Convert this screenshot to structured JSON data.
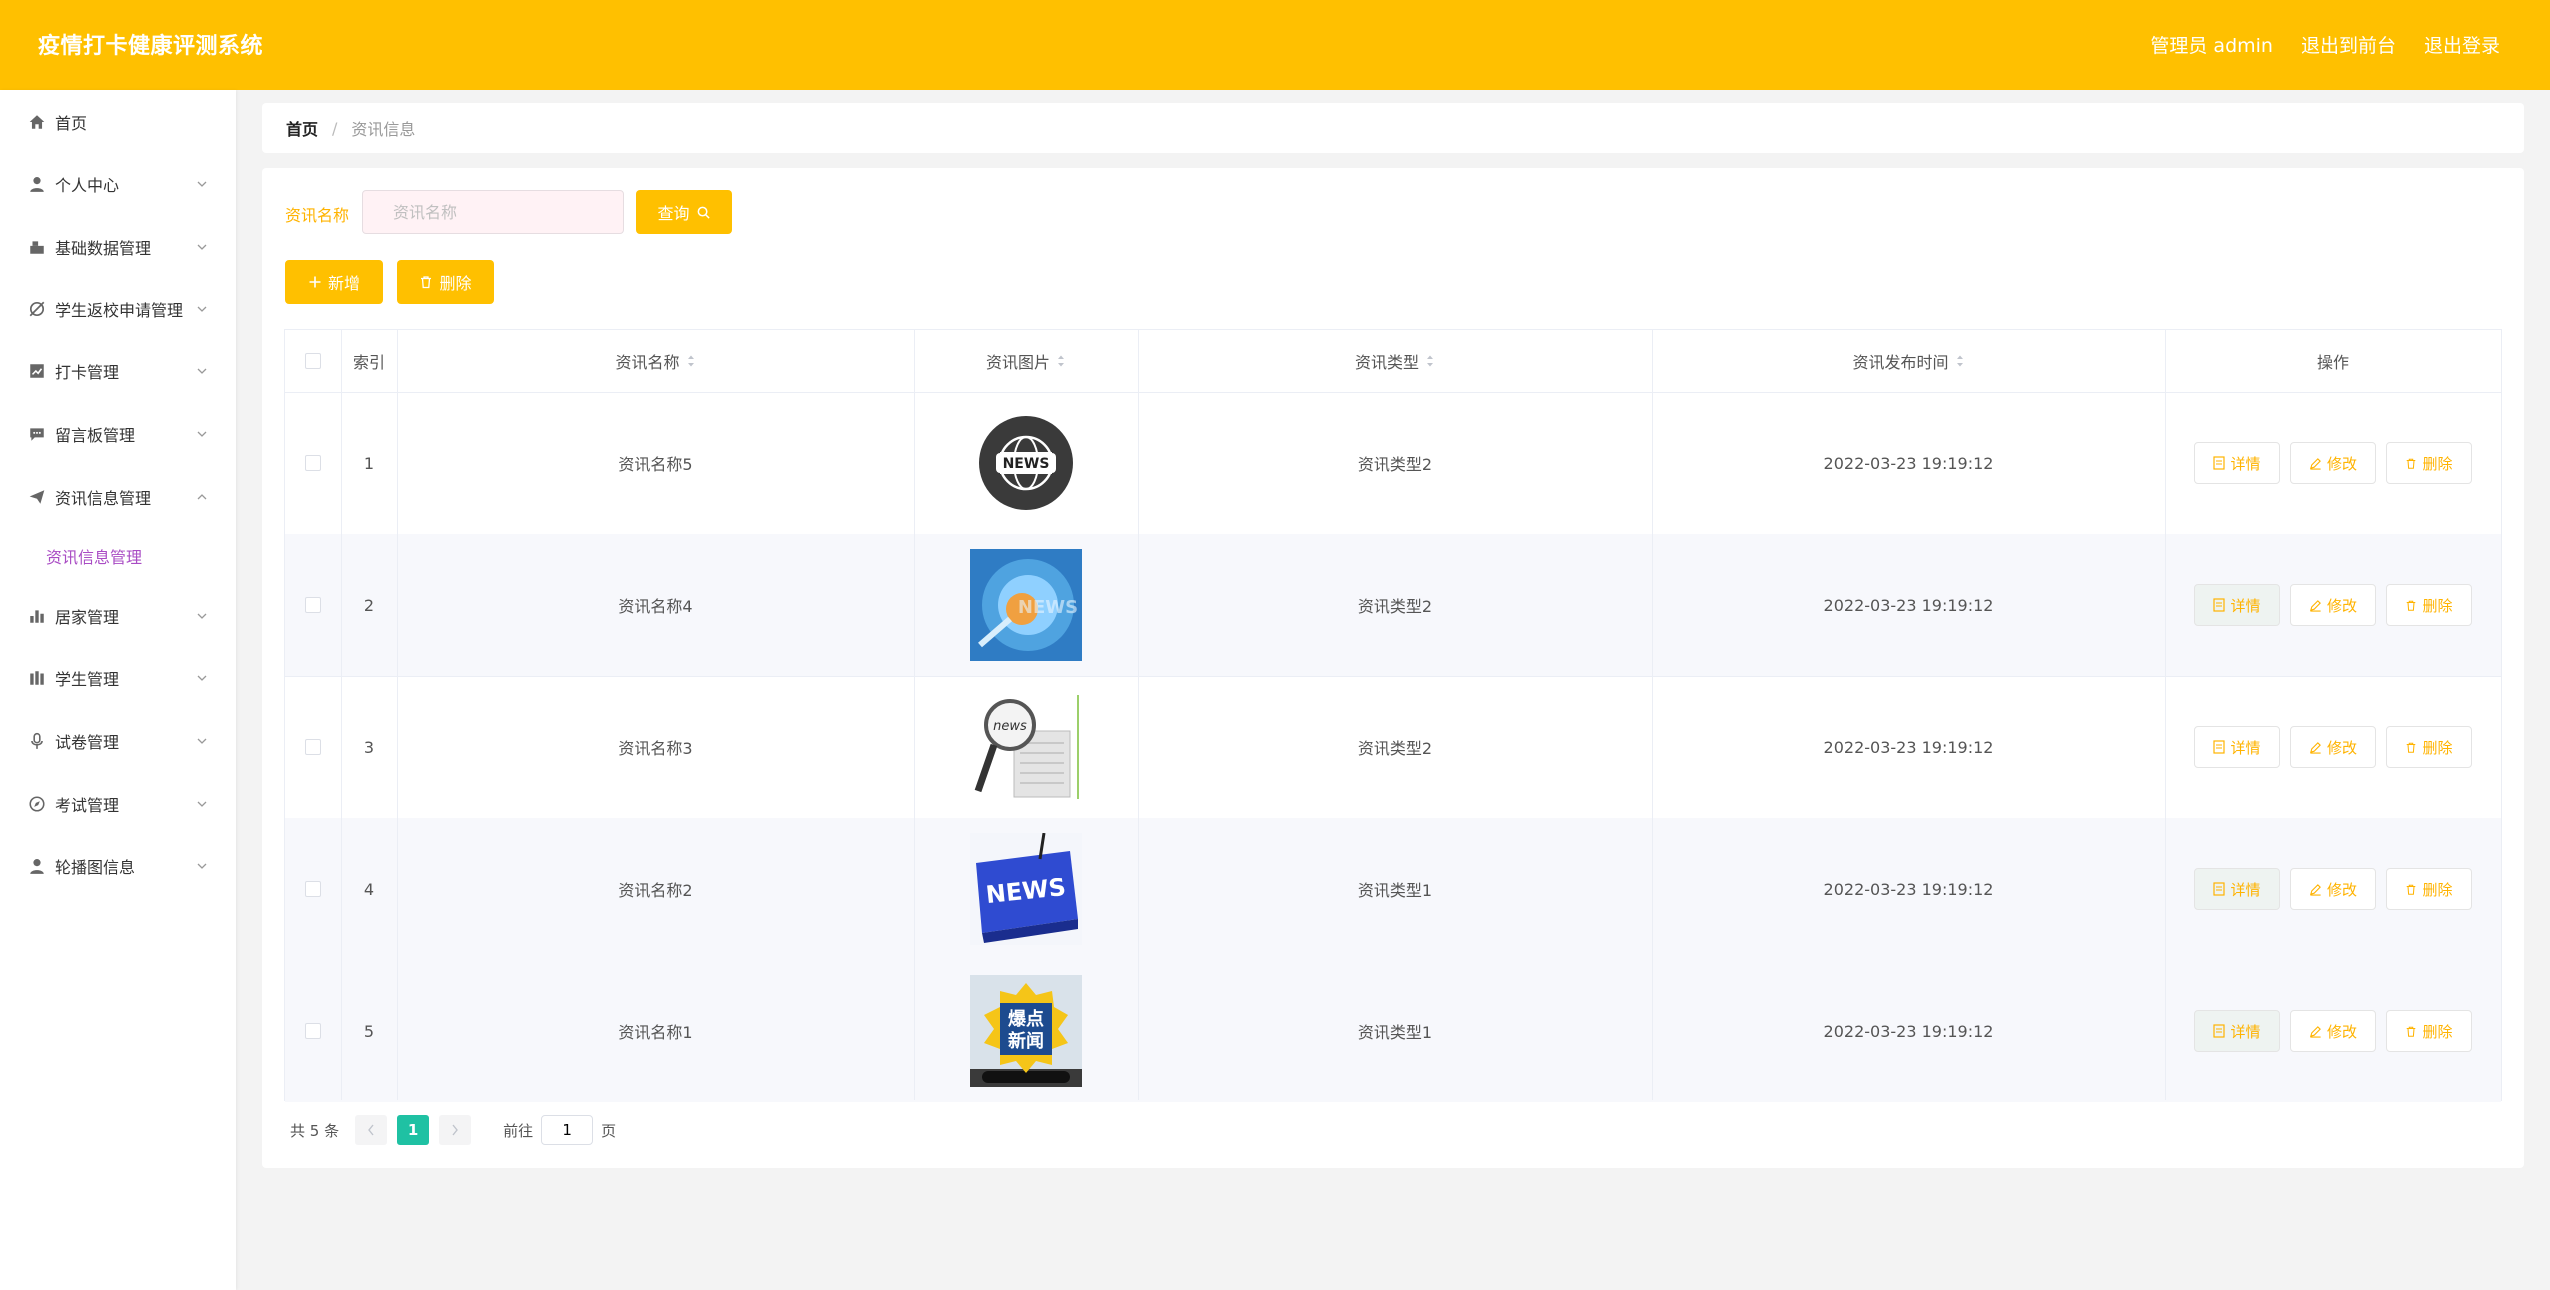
{
  "header": {
    "title": "疫情打卡健康评测系统",
    "links": [
      "管理员 admin",
      "退出到前台",
      "退出登录"
    ]
  },
  "sidebar": {
    "items": [
      {
        "label": "首页",
        "icon": "home-icon",
        "chevron": false
      },
      {
        "label": "个人中心",
        "icon": "user-icon",
        "chevron": true
      },
      {
        "label": "基础数据管理",
        "icon": "data-icon",
        "chevron": true
      },
      {
        "label": "学生返校申请管理",
        "icon": "no-notify-icon",
        "chevron": true
      },
      {
        "label": "打卡管理",
        "icon": "chart-icon",
        "chevron": true
      },
      {
        "label": "留言板管理",
        "icon": "message-icon",
        "chevron": true
      },
      {
        "label": "资讯信息管理",
        "icon": "send-icon",
        "chevron": true,
        "expanded": true
      },
      {
        "label": "居家管理",
        "icon": "bar-chart-icon",
        "chevron": true
      },
      {
        "label": "学生管理",
        "icon": "school-icon",
        "chevron": true
      },
      {
        "label": "试卷管理",
        "icon": "mic-icon",
        "chevron": true
      },
      {
        "label": "考试管理",
        "icon": "compass-icon",
        "chevron": true
      },
      {
        "label": "轮播图信息",
        "icon": "person-icon",
        "chevron": true
      }
    ],
    "active_sub": "资讯信息管理"
  },
  "breadcrumb": {
    "home": "首页",
    "separator": "/",
    "current": "资讯信息"
  },
  "search": {
    "label": "资讯名称",
    "placeholder": "资讯名称",
    "value": "",
    "button": "查询"
  },
  "actions": {
    "add": "新增",
    "delete": "删除"
  },
  "table": {
    "columns": [
      "索引",
      "资讯名称",
      "资讯图片",
      "资讯类型",
      "资讯发布时间",
      "操作"
    ],
    "rows": [
      {
        "index": "1",
        "name": "资讯名称5",
        "image": "globe-news-image",
        "type": "资讯类型2",
        "time": "2022-03-23 19:19:12"
      },
      {
        "index": "2",
        "name": "资讯名称4",
        "image": "blue-news-image",
        "type": "资讯类型2",
        "time": "2022-03-23 19:19:12"
      },
      {
        "index": "3",
        "name": "资讯名称3",
        "image": "magnifier-news-image",
        "type": "资讯类型2",
        "time": "2022-03-23 19:19:12"
      },
      {
        "index": "4",
        "name": "资讯名称2",
        "image": "news-key-image",
        "type": "资讯类型1",
        "time": "2022-03-23 19:19:12"
      },
      {
        "index": "5",
        "name": "资讯名称1",
        "image": "hot-news-image",
        "type": "资讯类型1",
        "time": "2022-03-23 19:19:12"
      }
    ],
    "op_labels": {
      "detail": "详情",
      "edit": "修改",
      "delete": "删除"
    },
    "image_texts": {
      "news": "NEWS",
      "hot_news_line1": "爆点",
      "hot_news_line2": "新闻"
    }
  },
  "pagination": {
    "total_text": "共 5 条",
    "current_page": "1",
    "goto_label": "前往",
    "goto_value": "1",
    "page_suffix": "页"
  },
  "colors": {
    "accent": "#ffc000",
    "submenu_active": "#a94cc4",
    "page_active": "#1fc1a3"
  }
}
